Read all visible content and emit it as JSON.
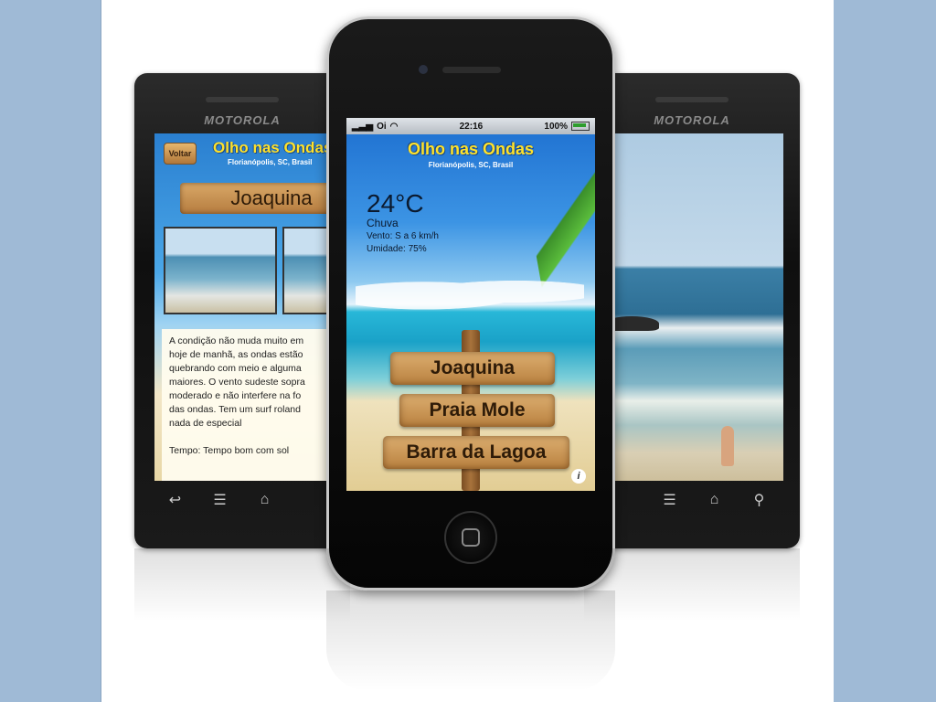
{
  "brand": {
    "device_brand": "MOTOROLA"
  },
  "left_screen": {
    "back_label": "Voltar",
    "app_title": "Olho nas Ondas",
    "location": "Florianópolis, SC, Brasil",
    "beach_sign": "Joaquina",
    "report": "A condição não muda muito em\nhoje de manhã, as ondas estão\nquebrando com meio e alguma\nmaiores. O vento sudeste sopra\nmoderado e não interfere na fo\ndas ondas. Tem um surf roland\nnada de especial\n\nTempo: Tempo bom com sol"
  },
  "iphone": {
    "status": {
      "carrier": "Oi",
      "time": "22:16",
      "battery": "100%"
    },
    "app_title": "Olho nas Ondas",
    "location": "Florianópolis, SC, Brasil",
    "weather": {
      "temperature": "24°C",
      "condition": "Chuva",
      "wind": "Vento: S a 6 km/h",
      "humidity": "Umidade: 75%"
    },
    "signs": [
      "Joaquina",
      "Praia Mole",
      "Barra da Lagoa"
    ],
    "info_label": "i"
  },
  "nav_icons": [
    "back-icon",
    "menu-icon",
    "home-icon",
    "search-icon"
  ],
  "colors": {
    "title_yellow": "#ffe22b",
    "sky_blue": "#1d6fd0",
    "wood": "#c68f4e",
    "frame_blue": "#9fbad6"
  }
}
